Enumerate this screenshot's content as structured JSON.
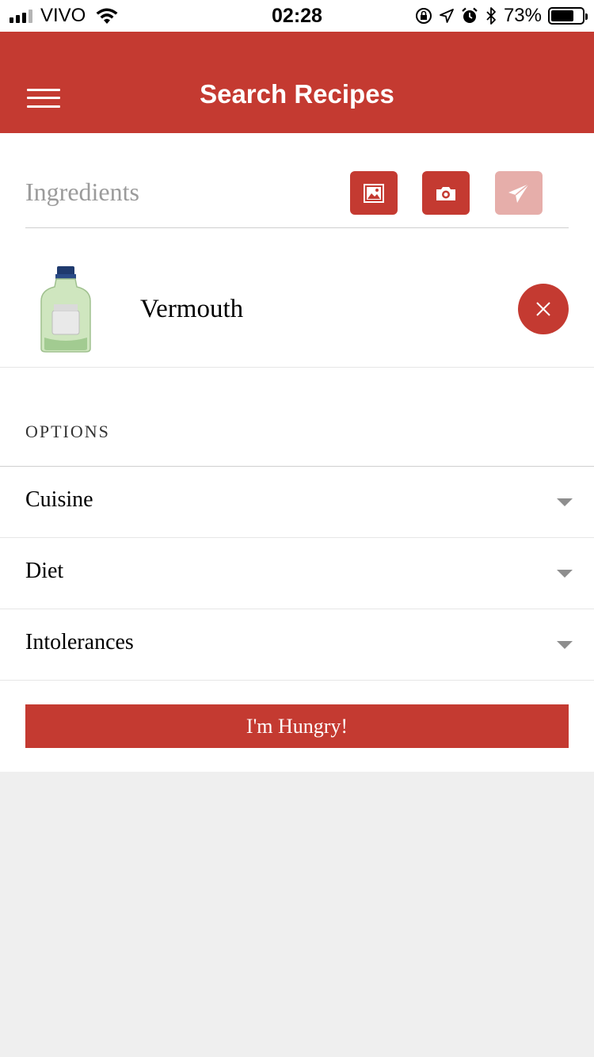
{
  "status_bar": {
    "carrier": "VIVO",
    "time": "02:28",
    "battery_percent": "73%",
    "battery_level": 0.73,
    "icons": [
      "signal-icon",
      "wifi-icon",
      "orientation-lock-icon",
      "location-icon",
      "alarm-icon",
      "bluetooth-icon",
      "battery-icon"
    ]
  },
  "navbar": {
    "title": "Search Recipes",
    "menu_icon": "hamburger-icon"
  },
  "ingredients": {
    "placeholder": "Ingredients",
    "buttons": [
      {
        "icon": "image-icon",
        "enabled": true
      },
      {
        "icon": "camera-icon",
        "enabled": true
      },
      {
        "icon": "send-icon",
        "enabled": false
      }
    ],
    "items": [
      {
        "name": "Vermouth",
        "thumbnail": "vermouth-bottle-image",
        "remove_icon": "close-icon"
      }
    ]
  },
  "options": {
    "header": "OPTIONS",
    "rows": [
      {
        "label": "Cuisine"
      },
      {
        "label": "Diet"
      },
      {
        "label": "Intolerances"
      }
    ]
  },
  "submit_button": {
    "label": "I'm Hungry!"
  },
  "colors": {
    "primary": "#c43a31",
    "primary_disabled": "#e6aeaa",
    "background": "#efefef",
    "placeholder_text": "#9b9b9b"
  }
}
